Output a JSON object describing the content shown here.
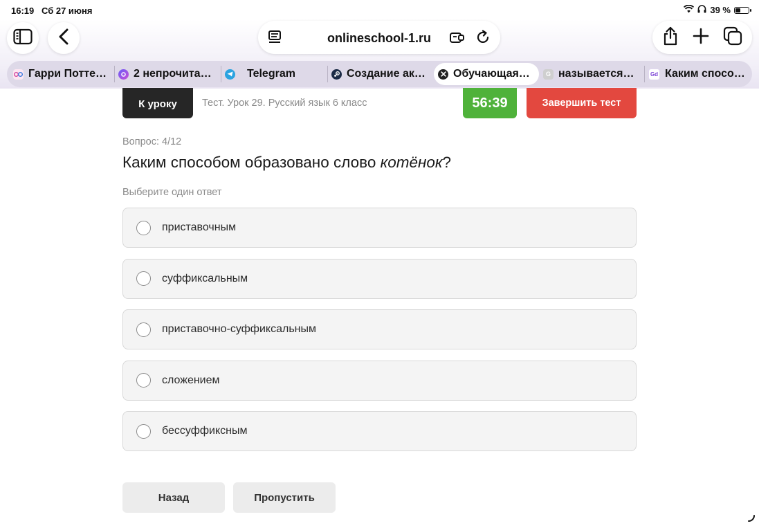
{
  "status_bar": {
    "time": "16:19",
    "date": "Сб 27 июня",
    "battery_text": "39 %",
    "battery_level_percent": 39
  },
  "browser": {
    "url": "onlineschool-1.ru",
    "icons": {
      "sidebar": "sidebar-icon",
      "back": "chevron-left-icon",
      "reader": "reader-icon",
      "extensions": "extensions-icon",
      "reload": "reload-icon",
      "share": "share-icon",
      "new_tab": "plus-icon",
      "tabs_overview": "tabs-icon"
    },
    "tabs": [
      {
        "label": "Гарри Потте…",
        "favicon": "owl-favicon",
        "active": false
      },
      {
        "label": "2 непрочита…",
        "favicon": "mail-favicon",
        "active": false
      },
      {
        "label": "Telegram",
        "favicon": "telegram-favicon",
        "active": false
      },
      {
        "label": "Создание ак…",
        "favicon": "steam-favicon",
        "active": false
      },
      {
        "label": "Обучающая…",
        "favicon": "close-icon",
        "active": true
      },
      {
        "label": "называется…",
        "favicon": "gray-favicon",
        "active": false
      },
      {
        "label": "Каким спосо…",
        "favicon": "gd-favicon",
        "active": false
      }
    ]
  },
  "header": {
    "lesson_button": "К уроку",
    "test_title": "Тест. Урок 29. Русский язык 6 класс",
    "timer": "56:39",
    "finish_button": "Завершить тест"
  },
  "question": {
    "counter": "Вопрос: 4/12",
    "text_before": "Каким способом образовано слово ",
    "keyword": "котёнок",
    "text_after": "?",
    "hint": "Выберите один ответ",
    "options": [
      {
        "label": "приставочным"
      },
      {
        "label": "суффиксальным"
      },
      {
        "label": "приставочно-суффиксальным"
      },
      {
        "label": "сложением"
      },
      {
        "label": "бессуффиксным"
      }
    ]
  },
  "footer": {
    "back_button": "Назад",
    "skip_button": "Пропустить"
  },
  "colors": {
    "timer_bg": "#4fb23a",
    "finish_bg": "#e3483f",
    "lesson_bg": "#262626"
  }
}
